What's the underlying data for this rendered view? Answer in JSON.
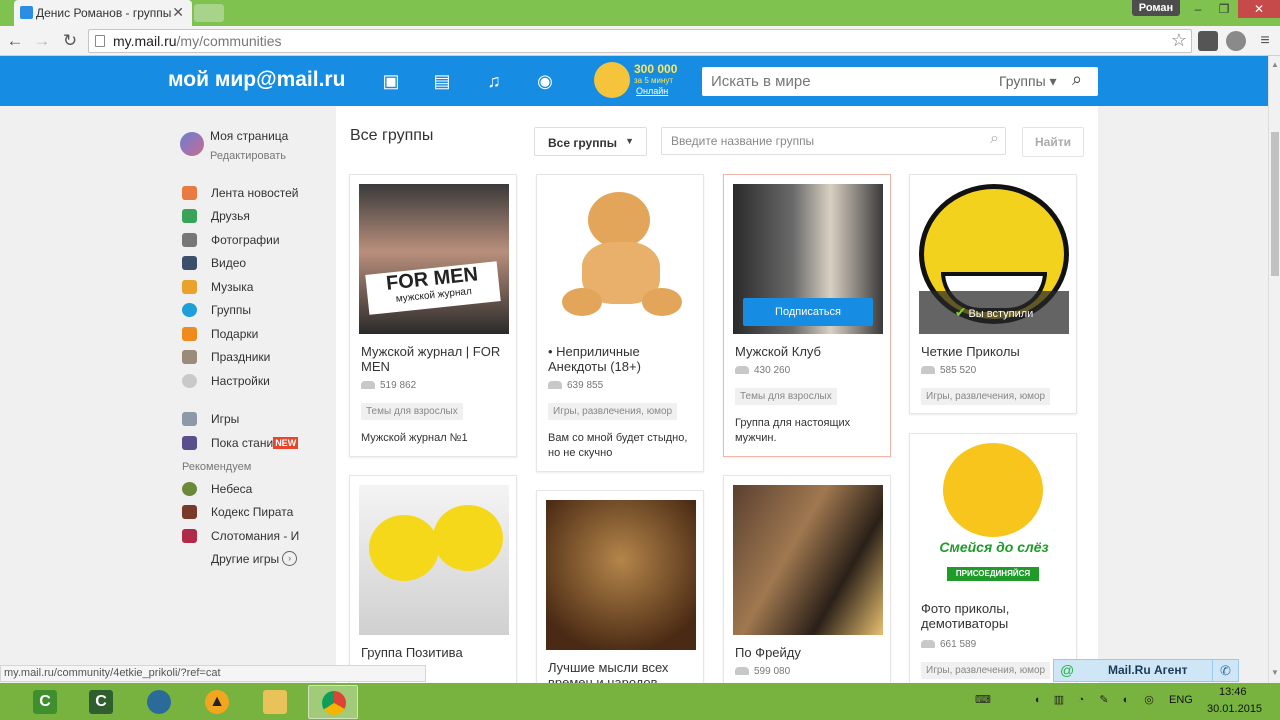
{
  "browser": {
    "tab_title": "Денис Романов - группы",
    "user_button": "Роман",
    "url_host": "my.mail.ru",
    "url_path": "/my/communities",
    "status_url": "my.mail.ru/community/4etkie_prikoli/?ref=cat"
  },
  "header": {
    "logo": "мой мир@mail.ru",
    "promo": {
      "amount": "300 000",
      "subtitle": "за 5 минут",
      "link": "Онлайн"
    },
    "search_placeholder": "Искать в мире",
    "search_scope": "Группы"
  },
  "sidebar": {
    "profile_name": "Моя страница",
    "profile_edit": "Редактировать",
    "items": [
      {
        "label": "Лента новостей",
        "icon": "home-icon",
        "color": "#e87a42"
      },
      {
        "label": "Друзья",
        "icon": "friends-icon",
        "color": "#3aa35a"
      },
      {
        "label": "Фотографии",
        "icon": "camera-icon",
        "color": "#777777"
      },
      {
        "label": "Видео",
        "icon": "video-icon",
        "color": "#3c4f6a"
      },
      {
        "label": "Музыка",
        "icon": "music-icon",
        "color": "#e9a32c"
      },
      {
        "label": "Группы",
        "icon": "groups-icon",
        "color": "#1f9fd8"
      },
      {
        "label": "Подарки",
        "icon": "gift-icon",
        "color": "#f08a1c"
      },
      {
        "label": "Праздники",
        "icon": "calendar-icon",
        "color": "#9a8b7a"
      },
      {
        "label": "Настройки",
        "icon": "gear-icon",
        "color": "#c9c9c9"
      }
    ],
    "games": [
      {
        "label": "Игры",
        "icon": "games-icon",
        "color": "#8c9aa8"
      },
      {
        "label": "Пока стани",
        "icon": "game-poka-icon",
        "color": "#5a4f8c",
        "badge": "NEW"
      }
    ],
    "recommended_label": "Рекомендуем",
    "recommended": [
      {
        "label": "Небеса",
        "icon": "game-nebesa-icon",
        "color": "#6a8a3a"
      },
      {
        "label": "Кодекс Пирата",
        "icon": "game-pirate-icon",
        "color": "#7a3a2a"
      },
      {
        "label": "Слотомания - И",
        "icon": "game-sloto-icon",
        "color": "#b02a4a"
      }
    ],
    "more_games": "Другие игры"
  },
  "main": {
    "title": "Все группы",
    "filter": "Все группы",
    "group_search_placeholder": "Введите название группы",
    "find_button": "Найти",
    "subscribe_label": "Подписаться",
    "joined_label": "Вы вступили",
    "cards": [
      {
        "name": "Мужской журнал | FOR MEN",
        "members": "519 862",
        "category": "Темы для взрослых",
        "desc": "Мужской журнал №1"
      },
      {
        "name": "• Неприличные Анекдоты (18+)",
        "members": "639 855",
        "category": "Игры, развлечения, юмор",
        "desc": "Вам со мной будет стыдно, но не скучно"
      },
      {
        "name": "Мужской Клуб",
        "members": "430 260",
        "category": "Темы для взрослых",
        "desc": "Группа для настоящих мужчин."
      },
      {
        "name": "Четкие Приколы",
        "members": "585 520",
        "category": "Игры, развлечения, юмор",
        "desc": ""
      },
      {
        "name": "Группа Позитива",
        "members": "",
        "category": "",
        "desc": ""
      },
      {
        "name": "Лучшие мысли всех времен и народов",
        "members": "",
        "category": "",
        "desc": ""
      },
      {
        "name": "По Фрейду",
        "members": "599 080",
        "category": "",
        "desc": ""
      },
      {
        "name": "Фото приколы, демотиваторы",
        "members": "661 589",
        "category": "Игры, развлечения, юмор",
        "desc": ""
      }
    ],
    "images": {
      "formen_text": "FOR MEN",
      "formen_sub": "мужской журнал",
      "laugh_text": "Смейся до слёз",
      "laugh_join": "ПРИСОЕДИНЯЙСЯ"
    }
  },
  "agent": {
    "label": "Mail.Ru Агент"
  },
  "taskbar": {
    "lang": "ENG",
    "time": "13:46",
    "date": "30.01.2015"
  }
}
